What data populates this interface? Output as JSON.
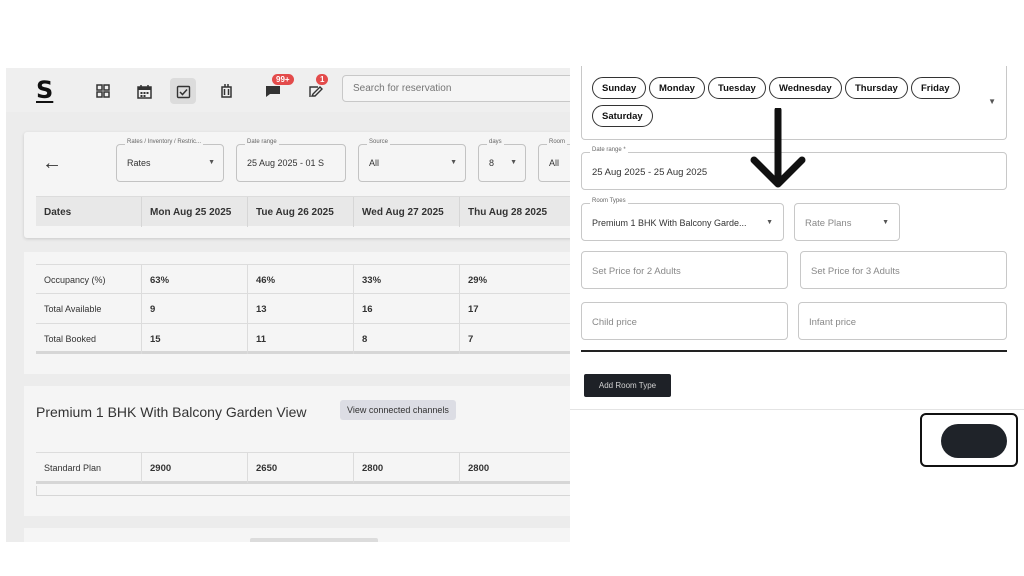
{
  "app": {
    "logo": "S",
    "nav": {
      "messages_badge": "99+",
      "alerts_badge": "1"
    },
    "search": {
      "placeholder": "Search for reservation"
    }
  },
  "filters": {
    "rates_inventory": {
      "label": "Rates / Inventory / Restric...",
      "value": "Rates"
    },
    "date_range": {
      "label": "Date range",
      "value": "25 Aug 2025 - 01 S"
    },
    "source": {
      "label": "Source",
      "value": "All"
    },
    "days": {
      "label": "days",
      "value": "8"
    },
    "room": {
      "label": "Room",
      "value": "All"
    }
  },
  "dates_header": {
    "label": "Dates",
    "columns": [
      "Mon Aug 25 2025",
      "Tue Aug 26 2025",
      "Wed Aug 27 2025",
      "Thu Aug 28 2025"
    ]
  },
  "stats": {
    "rows": [
      {
        "label": "Occupancy (%)",
        "values": [
          "63%",
          "46%",
          "33%",
          "29%"
        ]
      },
      {
        "label": "Total Available",
        "values": [
          "9",
          "13",
          "16",
          "17"
        ]
      },
      {
        "label": "Total Booked",
        "values": [
          "15",
          "11",
          "8",
          "7"
        ]
      }
    ]
  },
  "room": {
    "title": "Premium 1 BHK With Balcony Garden View",
    "view_channels": "View connected channels",
    "plan": {
      "label": "Standard Plan",
      "values": [
        "2900",
        "2650",
        "2800",
        "2800"
      ]
    }
  },
  "panel": {
    "days": [
      "Sunday",
      "Monday",
      "Tuesday",
      "Wednesday",
      "Thursday",
      "Friday",
      "Saturday"
    ],
    "date_range": {
      "label": "Date range *",
      "value": "25 Aug 2025 - 25 Aug 2025"
    },
    "room_types": {
      "label": "Room Types",
      "value": "Premium 1 BHK With Balcony Garde..."
    },
    "rate_plans": {
      "placeholder": "Rate Plans"
    },
    "price_2_adults": "Set Price for 2 Adults",
    "price_3_adults": "Set Price for 3 Adults",
    "child_price": "Child price",
    "infant_price": "Infant price",
    "add_room_type": "Add Room Type"
  },
  "colors": {
    "accent_dark": "#1e2127",
    "badge_red": "#e34b4b",
    "chip_border": "#333333"
  }
}
